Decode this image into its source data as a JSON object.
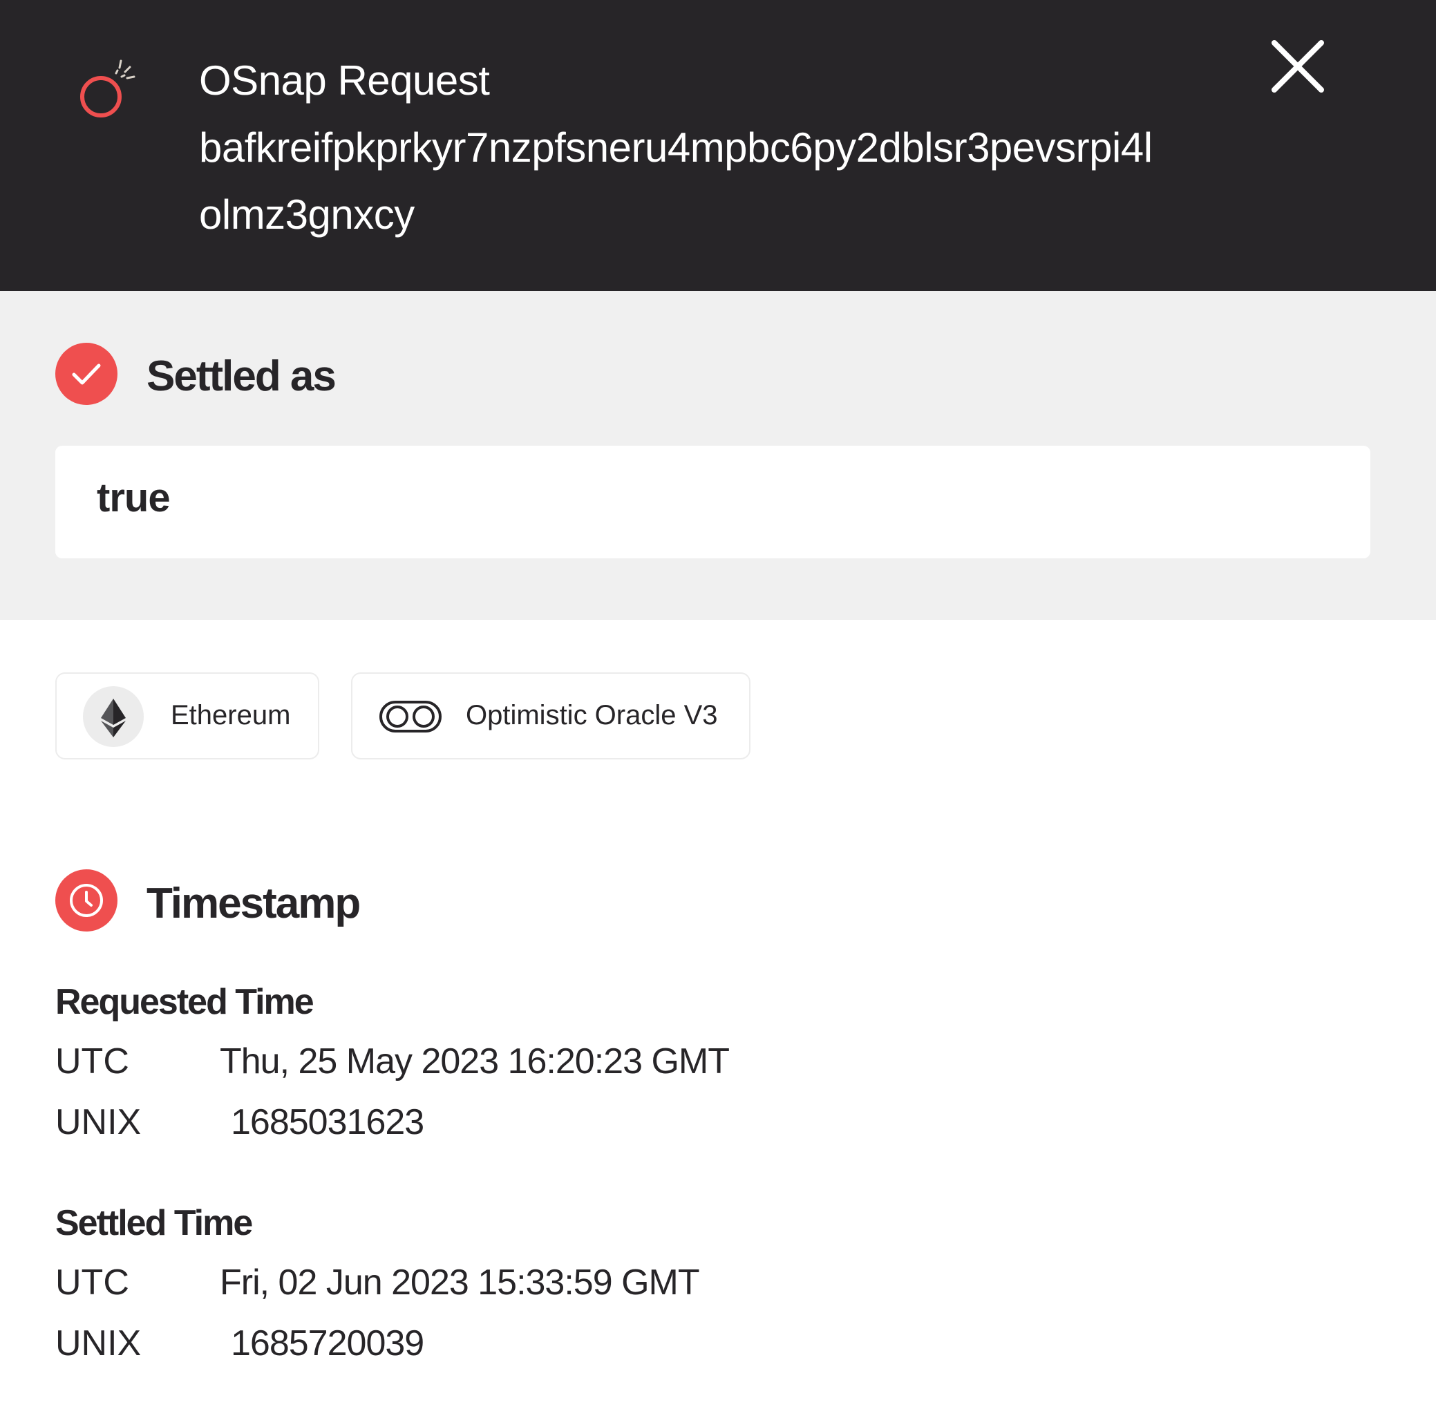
{
  "header": {
    "title_line1": "OSnap Request",
    "title_line2": "bafkreifpkprkyr7nzpfsneru4mpbc6py2dblsr3pevsrpi4l",
    "title_line3": "olmz3gnxcy",
    "logo_icon": "osnap-logo-icon",
    "close_icon": "close-icon"
  },
  "settled": {
    "heading": "Settled as",
    "icon": "check-icon",
    "value": "true"
  },
  "chips": [
    {
      "label": "Ethereum",
      "icon": "ethereum-icon"
    },
    {
      "label": "Optimistic Oracle V3",
      "icon": "oracle-icon"
    }
  ],
  "timestamp": {
    "heading": "Timestamp",
    "icon": "clock-icon",
    "requested": {
      "title": "Requested Time",
      "utc_label": "UTC",
      "utc_value": "Thu, 25 May 2023 16:20:23 GMT",
      "unix_label": "UNIX",
      "unix_value": "1685031623"
    },
    "settled": {
      "title": "Settled Time",
      "utc_label": "UTC",
      "utc_value": "Fri, 02 Jun 2023 15:33:59 GMT",
      "unix_label": "UNIX",
      "unix_value": "1685720039"
    }
  },
  "colors": {
    "header_bg": "#272528",
    "accent": "#ef4f4f",
    "section_bg": "#f0f0f0",
    "text": "#272528"
  }
}
